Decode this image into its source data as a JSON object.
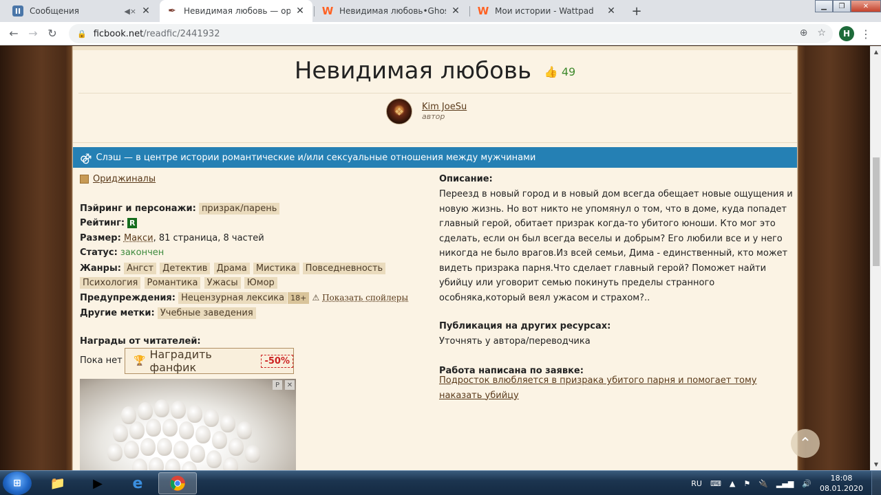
{
  "tabs": [
    {
      "title": "Сообщения",
      "icon": "vk-icon",
      "color": "#4a76a8",
      "glyph": "II",
      "muted": true
    },
    {
      "title": "Невидимая любовь — ориджинал",
      "icon": "ficbook-feather-icon",
      "color": "#7a3b2e",
      "glyph": "✒",
      "active": true
    },
    {
      "title": "Невидимая любовь•Ghost - Гла",
      "icon": "wattpad-icon",
      "color": "#ff6122",
      "glyph": "W"
    },
    {
      "title": "Мои истории - Wattpad",
      "icon": "wattpad-icon",
      "color": "#ff6122",
      "glyph": "W"
    }
  ],
  "address": {
    "host": "ficbook.net",
    "path": "/readfic/2441932"
  },
  "profile_letter": "H",
  "fic": {
    "title": "Невидимая любовь",
    "likes": "49",
    "author_name": "Kim JoeSu",
    "author_role": "автор",
    "direction": "Слэш — в центре истории романтические и/или сексуальные отношения между мужчинами",
    "fandom": "Ориджиналы",
    "pairing_label": "Пэйринг и персонажи:",
    "pairing_value": "призрак/парень",
    "rating_label": "Рейтинг:",
    "rating_value": "R",
    "size_label": "Размер:",
    "size_link": "Макси",
    "size_rest": ", 81 страница, 8 частей",
    "status_label": "Статус:",
    "status_value": "закончен",
    "genres_label": "Жанры:",
    "genres": [
      "Ангст",
      "Детектив",
      "Драма",
      "Мистика",
      "Повседневность",
      "Психология",
      "Романтика",
      "Ужасы",
      "Юмор"
    ],
    "warnings_label": "Предупреждения:",
    "warnings_value": "Нецензурная лексика",
    "warnings_age": "18+",
    "show_spoilers": "Показать спойлеры",
    "other_tags_label": "Другие метки:",
    "other_tags_value": "Учебные заведения",
    "awards_label": "Награды от читателей:",
    "awards_none": "Пока нет",
    "award_button": "Наградить фанфик",
    "award_discount": "-50%",
    "description_label": "Описание:",
    "description": "Переезд в новый город и в новый дом всегда обещает новые ощущения и новую жизнь. Но вот никто не упомянул о том, что в доме, куда попадет главный герой, обитает призрак когда-то убитого юноши. Кто мог это сделать, если он был всегда веселы и добрым? Его любили все и у него никогда не было врагов.Из всей семьи, Дима - единственный, кто может видеть призрака парня.Что сделает главный герой? Поможет найти убийцу или уговорит семью покинуть пределы странного особняка,который веял ужасом и страхом?..",
    "publication_label": "Публикация на других ресурсах:",
    "publication_value": "Уточнять у автора/переводчика",
    "request_label": "Работа написана по заявке:",
    "request_link": "Подросток влюбляется в призрака убитого парня и помогает тому наказать убийцу"
  },
  "ad_badges": [
    "P",
    "✕"
  ],
  "taskbar": {
    "lang": "RU",
    "time": "18:08",
    "date": "08.01.2020"
  }
}
